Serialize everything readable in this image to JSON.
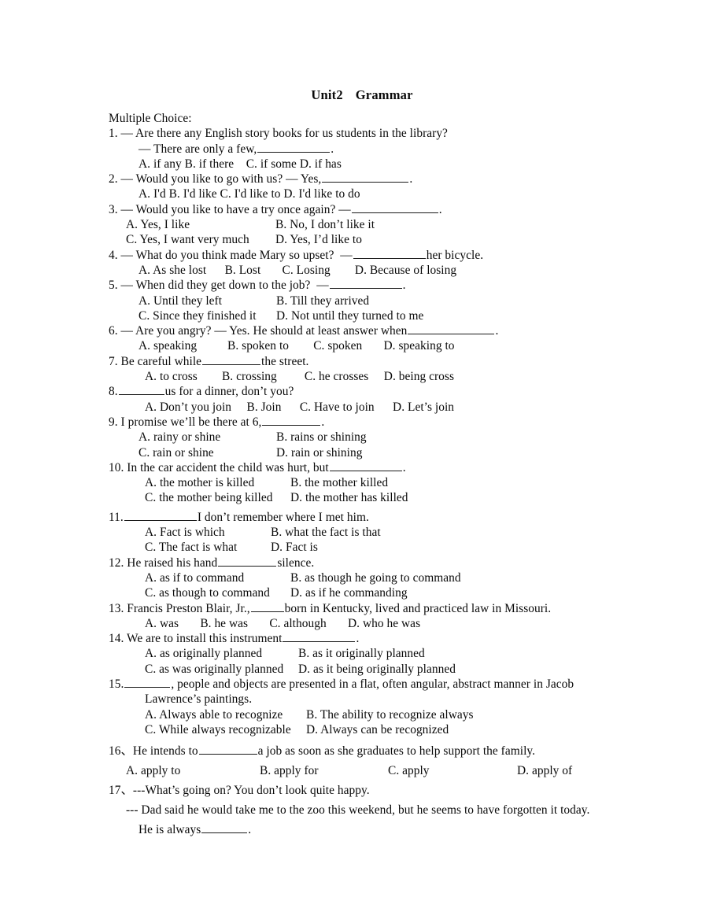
{
  "document": {
    "title_part1": "Unit2",
    "title_part2": "Grammar",
    "section_label": "Multiple Choice:",
    "questions": [
      {
        "number": "1.",
        "stem": "1. — Are there any English story books for us students in the library?",
        "stem_continued": "— There are only a few,",
        "stem_continued_tail": ".",
        "options_inline": "A. if any B. if there    C. if some D. if has"
      },
      {
        "number": "2.",
        "stem_pre": "2. — Would you like to go with us? — Yes,",
        "stem_post": ".",
        "options_inline": "A. I'd B. I'd like C. I'd like to D. I'd like to do"
      },
      {
        "number": "3.",
        "stem_pre": "3. — Would you like to have a try once again? —",
        "stem_post": ".",
        "optA": "A. Yes, I like",
        "optB": "B. No, I don’t like it",
        "optC": "C. Yes, I want very much",
        "optD": "D. Yes, I’d like to"
      },
      {
        "number": "4.",
        "stem_pre": "4. — What do you think made Mary so upset?  —",
        "stem_post": "her bicycle.",
        "options_inline": "A. As she lost      B. Lost       C. Losing        D. Because of losing"
      },
      {
        "number": "5.",
        "stem_pre": "5. — When did they get down to the job?  —",
        "stem_post": ".",
        "optA": "A. Until they left",
        "optB": "B. Till they arrived",
        "optC": "C. Since they finished it",
        "optD": "D. Not until they turned to me"
      },
      {
        "number": "6.",
        "stem_pre": "6. — Are you angry? — Yes. He should at least answer when",
        "stem_post": ".",
        "options_inline": "A. speaking          B. spoken to        C. spoken       D. speaking to"
      },
      {
        "number": "7.",
        "stem_pre": "7. Be careful while",
        "stem_post": "the street.",
        "options_inline": "A. to cross        B. crossing         C. he crosses     D. being cross"
      },
      {
        "number": "8.",
        "stem_pre": "8.",
        "stem_post": "us for a dinner, don’t you?",
        "options_inline": "A. Don’t you join     B. Join      C. Have to join      D. Let’s join"
      },
      {
        "number": "9.",
        "stem_pre": "9. I promise we’ll be there at 6,",
        "stem_post": ".",
        "optA": "A. rainy or shine",
        "optB": "B. rains or shining",
        "optC": "C. rain or shine",
        "optD": "D. rain or shining"
      },
      {
        "number": "10.",
        "stem_pre": "10. In the car accident the child was hurt, but",
        "stem_post": ".",
        "optA": "A. the mother is killed",
        "optB": "B. the mother killed",
        "optC": "C. the mother being killed",
        "optD": "D. the mother has killed"
      },
      {
        "number": "11.",
        "stem_pre": "11.",
        "stem_post": "I don’t remember where I met him.",
        "optA": "A. Fact is which",
        "optB": "B. what the fact is that",
        "optC": "C. The fact is what",
        "optD": "D. Fact is"
      },
      {
        "number": "12.",
        "stem_pre": "12. He raised his hand",
        "stem_post": "silence.",
        "optA": "A. as if to command",
        "optB": "B. as though he going to command",
        "optC": "C. as though to command",
        "optD": "D. as if he commanding"
      },
      {
        "number": "13.",
        "stem_pre": "13. Francis Preston Blair, Jr.,",
        "stem_post": "born in Kentucky, lived and practiced law in Missouri.",
        "options_inline": "A. was       B. he was       C. although       D. who he was"
      },
      {
        "number": "14.",
        "stem_pre": "14. We are to install this instrument",
        "stem_post": ".",
        "optA": "A. as originally planned",
        "optB": "B. as it originally planned",
        "optC": "C. as was originally planned",
        "optD": "D. as it being originally planned"
      },
      {
        "number": "15.",
        "stem_pre": "15.",
        "stem_post": ", people and objects are presented in a flat, often angular, abstract manner in Jacob",
        "stem_line2": "Lawrence’s paintings.",
        "optA": "A. Always able to recognize",
        "optB": "B. The ability to recognize always",
        "optC": "C. While always recognizable",
        "optD": "D. Always can be recognized"
      },
      {
        "number": "16、",
        "stem_pre": "16、He intends to",
        "stem_post": "a job as soon as she graduates to help support the family.",
        "optA": "A. apply to",
        "optB": "B. apply for",
        "optC": "C. apply",
        "optD": "D. apply of"
      },
      {
        "number": "17、",
        "stem_line1": "17、---What’s going on? You don’t look quite happy.",
        "stem_line2": "--- Dad said he would take me to the zoo this weekend, but he seems to have forgotten it today.",
        "stem_line3_pre": "He is always",
        "stem_line3_post": "."
      }
    ]
  }
}
